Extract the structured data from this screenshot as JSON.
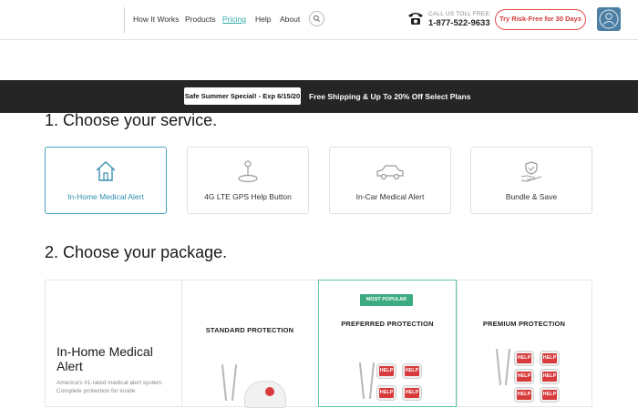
{
  "header": {
    "nav": [
      "How It Works",
      "Products",
      "Pricing",
      "Help",
      "About"
    ],
    "active_nav": "Pricing",
    "call_label": "CALL US TOLL FREE:",
    "phone": "1-877-522-9633",
    "cta": "Try Risk-Free for 30 Days"
  },
  "promo": {
    "badge": "Safe Summer Special! - Exp 6/15/20",
    "text": "Free Shipping & Up To 20% Off Select Plans"
  },
  "services": {
    "title": "1. Choose your service.",
    "items": [
      {
        "label": "In-Home Medical Alert",
        "icon": "house-icon",
        "selected": true
      },
      {
        "label": "4G LTE GPS Help Button",
        "icon": "location-person-icon",
        "selected": false
      },
      {
        "label": "In-Car Medical Alert",
        "icon": "car-icon",
        "selected": false
      },
      {
        "label": "Bundle & Save",
        "icon": "hand-shield-icon",
        "selected": false
      }
    ]
  },
  "packages": {
    "title": "2. Choose your package.",
    "intro_title": "In-Home Medical Alert",
    "intro_desc": "America's #1-rated medical alert system. Complete protection for inside",
    "badge": "MOST POPULAR",
    "plans": [
      {
        "name": "STANDARD PROTECTION"
      },
      {
        "name": "PREFERRED PROTECTION"
      },
      {
        "name": "PREMIUM PROTECTION"
      }
    ],
    "button_text": "HELP"
  },
  "colors": {
    "accent": "#2ea9a6",
    "cta_red": "#e24b4b",
    "selected_blue": "#4aa3c3",
    "popular_green": "#3cab82",
    "promo_bg": "#252525"
  }
}
